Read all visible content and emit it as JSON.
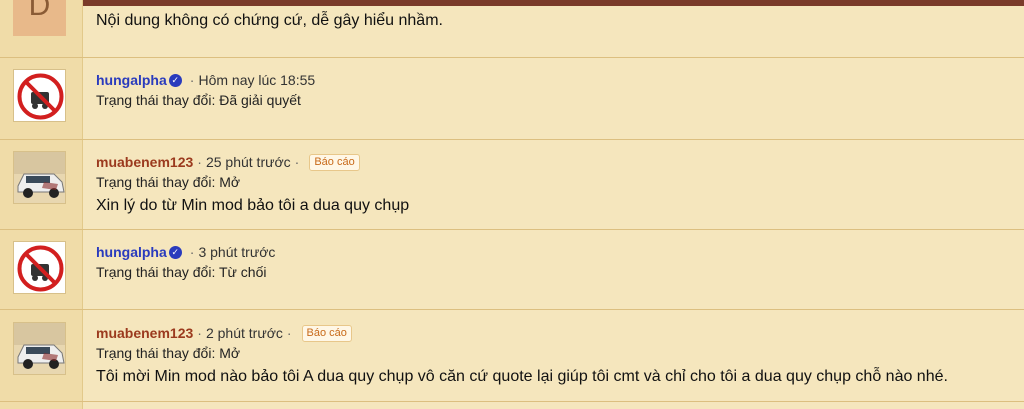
{
  "first": {
    "avatar_letter": "D",
    "message": "Nội dung không có chứng cứ, dễ gây hiểu nhầm."
  },
  "entries": [
    {
      "username": "hungalpha",
      "verified": true,
      "time": "Hôm nay lúc 18:55",
      "status": "Trạng thái thay đổi: Đã giải quyết",
      "avatar": "no-sign-avatar"
    },
    {
      "username": "muabenem123",
      "time": "25 phút trước",
      "report_label": "Báo cáo",
      "status": "Trạng thái thay đổi: Mở",
      "message": "Xin lý do từ Min mod bảo tôi a dua quy chụp",
      "avatar": "car-avatar"
    },
    {
      "username": "hungalpha",
      "verified": true,
      "time": "3 phút trước",
      "status": "Trạng thái thay đổi: Từ chối",
      "avatar": "no-sign-avatar"
    },
    {
      "username": "muabenem123",
      "time": "2 phút trước",
      "report_label": "Báo cáo",
      "status": "Trạng thái thay đổi: Mở",
      "message": "Tôi mời Min mod nào bảo tôi A dua quy chụp vô căn cứ quote lại giúp tôi cmt và chỉ cho tôi a dua quy chụp chỗ nào nhé.",
      "avatar": "car-avatar"
    }
  ]
}
